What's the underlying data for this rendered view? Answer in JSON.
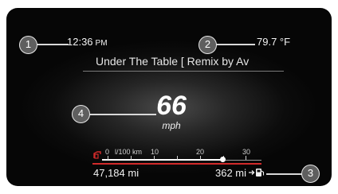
{
  "clock": {
    "time": "12:36",
    "period": "PM"
  },
  "climate": {
    "outside_temp": "79.7 °F"
  },
  "media": {
    "now_playing": "Under The Table [ Remix by Av"
  },
  "speedometer": {
    "speed": "66",
    "unit": "mph"
  },
  "fuel_economy": {
    "scale_labels": [
      "0",
      "l/100 km",
      "10",
      "20",
      "30"
    ],
    "current_fraction": 0.76
  },
  "trip": {
    "odometer": "47,184 mi",
    "range": "362 mi"
  },
  "callouts": [
    "1",
    "2",
    "3",
    "4"
  ],
  "colors": {
    "warning_red": "#d22a2a",
    "text": "#f2f2f2",
    "background": "#0c0c0c"
  },
  "icons": {
    "economy_gauge": "fuel-economy-icon",
    "fuel_pump": "fuel-pump-icon"
  }
}
